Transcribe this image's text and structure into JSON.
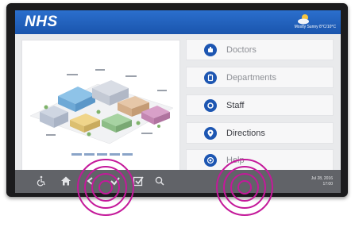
{
  "header": {
    "logo_text": "NHS",
    "weather_icon": "sun-cloud-icon",
    "weather_text": "Mostly Sunny 8°C/10°C"
  },
  "map": {
    "description_icon": "hospital-map"
  },
  "menu": {
    "items": [
      {
        "label": "Doctors",
        "icon": "doctor-icon"
      },
      {
        "label": "Departments",
        "icon": "clipboard-icon"
      },
      {
        "label": "Staff",
        "icon": "staff-icon"
      },
      {
        "label": "Directions",
        "icon": "location-pin-icon"
      },
      {
        "label": "Help",
        "icon": "lifebuoy-icon"
      }
    ]
  },
  "taskbar": {
    "icons": [
      "accessibility-icon",
      "home-icon",
      "back-icon",
      "check-icon",
      "checkbox-icon",
      "search-icon"
    ],
    "date": "Jul 28, 2016",
    "time": "17:00"
  },
  "colors": {
    "header_blue": "#1f5fbd",
    "accent_blue": "#1d56b2",
    "taskbar": "#616368",
    "ripple": "#c4199a"
  }
}
